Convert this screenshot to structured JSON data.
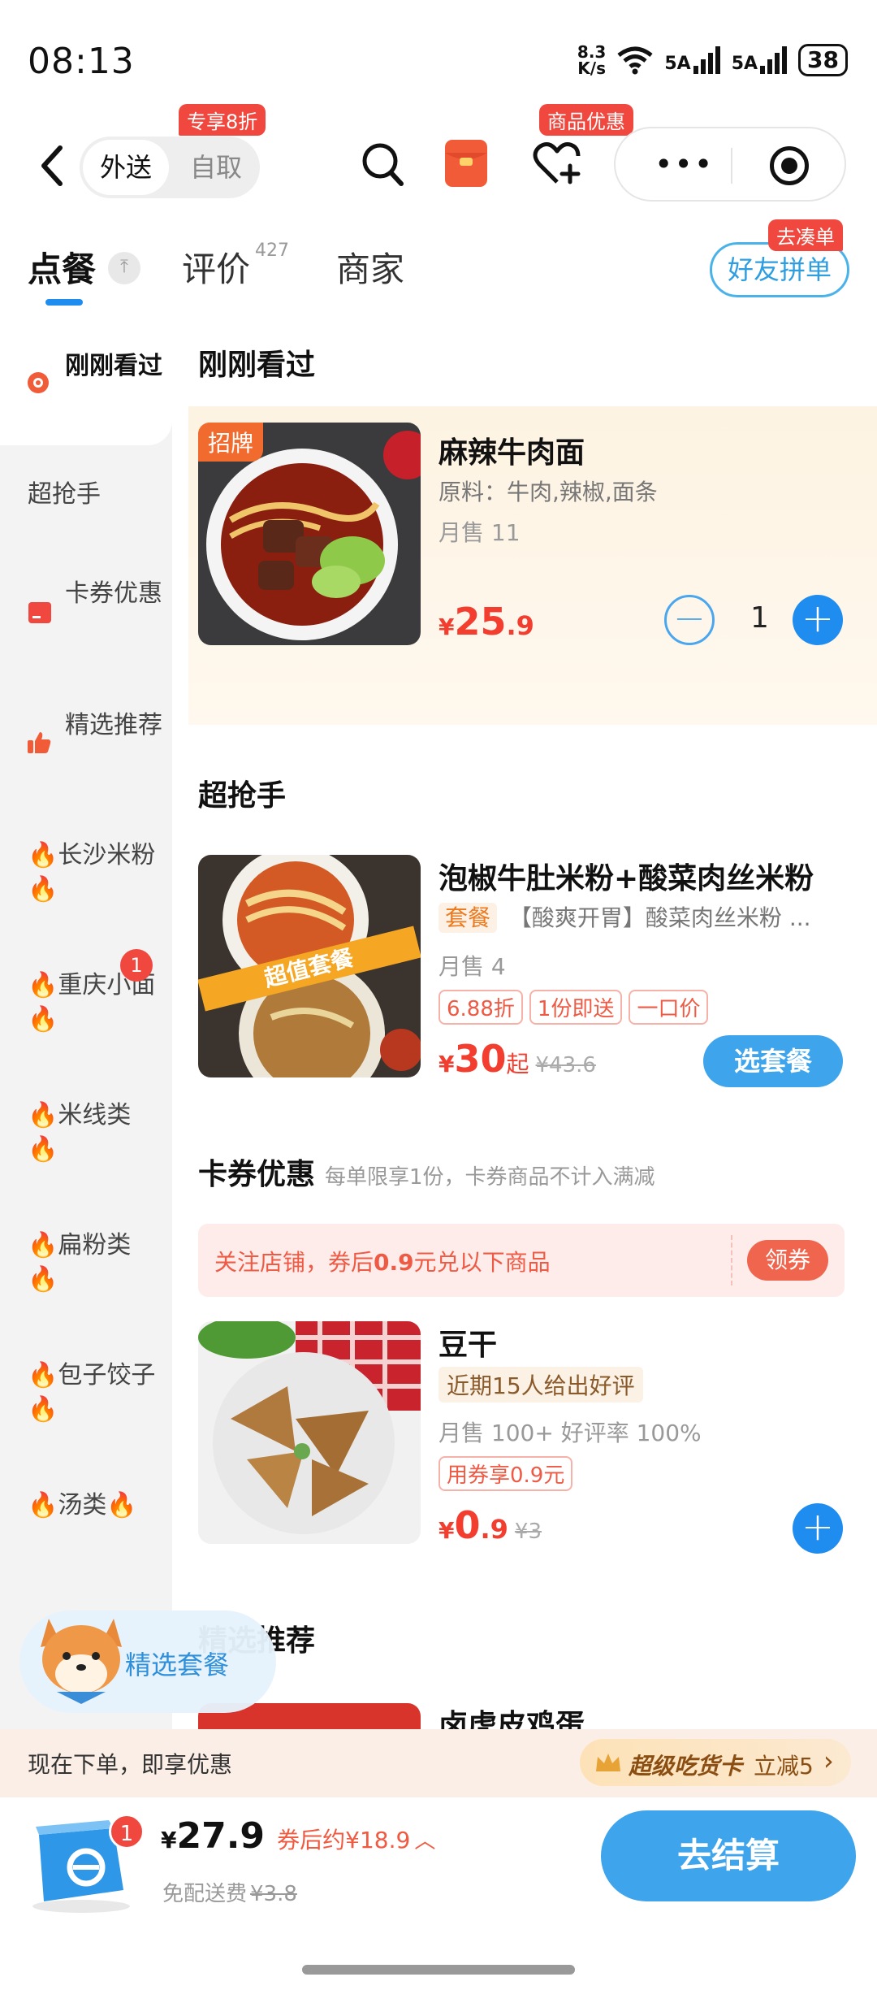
{
  "status_bar": {
    "time": "08:13",
    "net_speed_value": "8.3",
    "net_speed_unit": "K/s",
    "sig1_label": "5A",
    "sig2_label": "5A",
    "battery": "38"
  },
  "nav": {
    "mode_delivery": "外送",
    "mode_pickup": "自取",
    "pickup_badge": "专享8折",
    "fav_badge": "商品优惠",
    "icons": [
      "back-chevron-icon",
      "search-icon",
      "red-envelope-icon",
      "heart-plus-icon",
      "more-dots-icon",
      "target-icon"
    ]
  },
  "tabs": {
    "order": "点餐",
    "reviews": "评价",
    "review_count": "427",
    "merchant": "商家",
    "friend_order": "好友拼单",
    "friend_badge": "去凑单"
  },
  "sidebar": {
    "items": [
      {
        "label": "刚刚看过"
      },
      {
        "label": "超抢手"
      },
      {
        "label": "卡券优惠"
      },
      {
        "label": "精选推荐"
      },
      {
        "label": "🔥长沙米粉🔥"
      },
      {
        "label": "🔥重庆小面🔥",
        "badge": "1"
      },
      {
        "label": "🔥米线类🔥"
      },
      {
        "label": "🔥扁粉类🔥"
      },
      {
        "label": "🔥包子饺子🔥"
      },
      {
        "label": "🔥汤类🔥"
      }
    ],
    "mascot_label": "精选套餐"
  },
  "sections": {
    "recent": {
      "title": "刚刚看过",
      "item": {
        "tag": "招牌",
        "name": "麻辣牛肉面",
        "desc": "原料：牛肉,辣椒,面条",
        "sold": "月售 11",
        "price_cur": "¥",
        "price_int": "25",
        "price_dec": ".9",
        "qty": "1"
      }
    },
    "hot": {
      "title": "超抢手",
      "item": {
        "image_banner": "超值套餐",
        "name": "泡椒牛肚米粉+酸菜肉丝米粉",
        "set_tag": "套餐",
        "desc": "【酸爽开胃】酸菜肉丝米粉 ...",
        "sold": "月售 4",
        "chips": [
          "6.88折",
          "1份即送",
          "一口价"
        ],
        "price_cur": "¥",
        "price_int": "30",
        "price_suffix": "起",
        "orig": "¥43.6",
        "button": "选套餐"
      }
    },
    "coupon": {
      "title": "卡券优惠",
      "subtitle": "每单限享1份，卡券商品不计入满减",
      "banner_pre": "关注店铺，券后",
      "banner_amount": "0.9",
      "banner_post": "元兑以下商品",
      "banner_button": "领券",
      "item": {
        "name": "豆干",
        "review_tag": "近期15人给出好评",
        "sold": "月售 100+ 好评率 100%",
        "chip": "用券享0.9元",
        "price_cur": "¥",
        "price_int": "0",
        "price_dec": ".9",
        "orig": "¥3"
      }
    },
    "featured": {
      "title": "精选推荐",
      "item_name": "卤虎皮鸡蛋"
    }
  },
  "promo_bar": {
    "text": "现在下单，即享优惠",
    "card_name": "超级吃货卡",
    "discount": "立减5",
    "chevron": "›"
  },
  "cart": {
    "count": "1",
    "price_cur": "¥",
    "price": "27.9",
    "after_coupon": "券后约¥18.9",
    "delivery_label": "免配送费",
    "delivery_orig": "¥3.8",
    "checkout": "去结算"
  },
  "colors": {
    "accent_blue": "#1f8cf0",
    "price_red": "#f23d2f",
    "badge_red": "#f0483e"
  }
}
